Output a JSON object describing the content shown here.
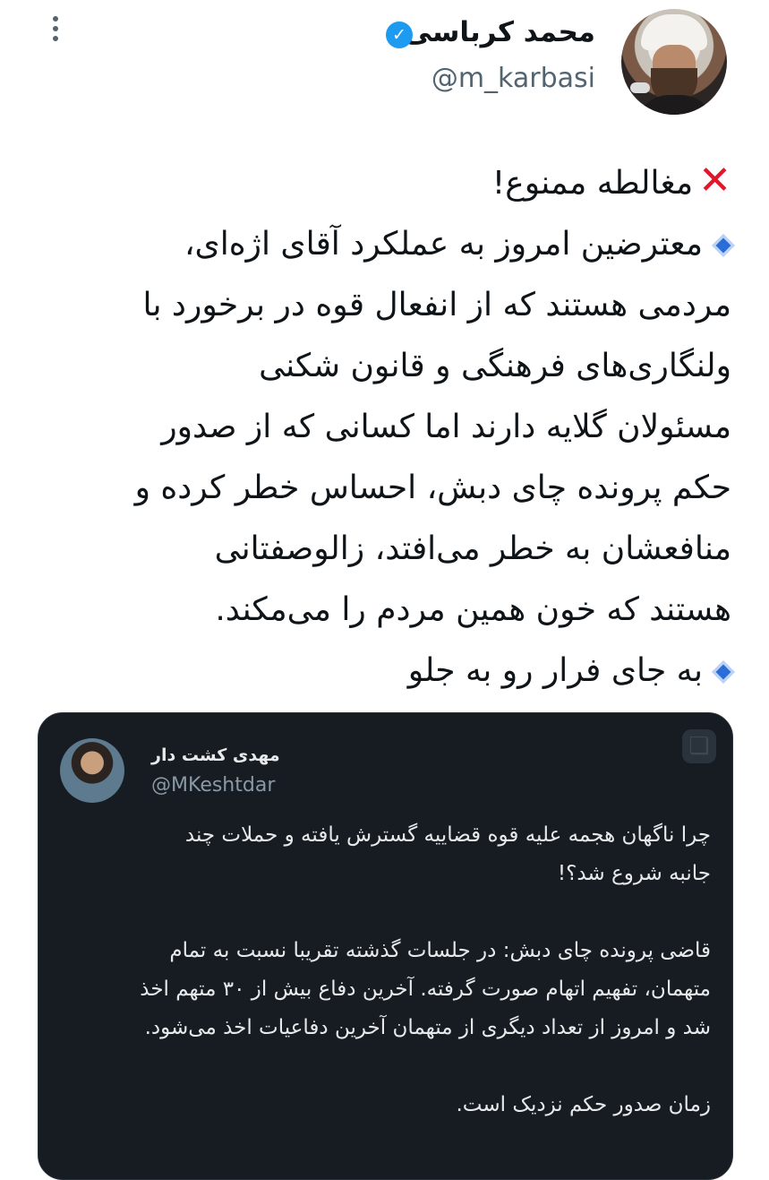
{
  "author": {
    "display_name": "محمد کرباسی",
    "handle": "@m_karbasi",
    "verified_icon": "verified-badge-icon"
  },
  "tweet": {
    "lines": [
      "مغالطه ممنوع!",
      "معترضین امروز به عملکرد آقای اژه‌ای،",
      "مردمی هستند که از انفعال قوه در برخورد با",
      "ولنگاری‌های فرهنگی و قانون شکنی",
      "مسئولان گلایه دارند اما کسانی که از صدور",
      "حکم پرونده چای دبش، احساس خطر کرده و",
      "منافعشان به خطر می‌افتد، زالوصفتانی",
      "هستند که خون همین مردم را می‌مکند.",
      "به جای فرار رو به جلو"
    ]
  },
  "quoted_tweet": {
    "display_name": "مهدی کشت دار",
    "handle": "@MKeshtdar",
    "paragraph1": [
      "چرا ناگهان هجمه علیه قوه قضاییه گسترش یافته و حملات چند",
      "جانبه شروع شد؟!"
    ],
    "paragraph2": [
      "قاضی پرونده چای دبش: در جلسات گذشته تقریبا نسبت به تمام",
      "متهمان، تفهیم اتهام صورت گرفته. آخرین دفاع بیش از ۳۰ متهم اخذ",
      "شد و امروز از تعداد دیگری از متهمان آخرین دفاعیات اخذ می‌شود."
    ],
    "paragraph3": [
      "زمان صدور حکم نزدیک است."
    ]
  },
  "colors": {
    "accent": "#1d9bf0",
    "cross": "#e2152a",
    "diamond": "#2b6cd6",
    "card_bg": "#161c22"
  }
}
